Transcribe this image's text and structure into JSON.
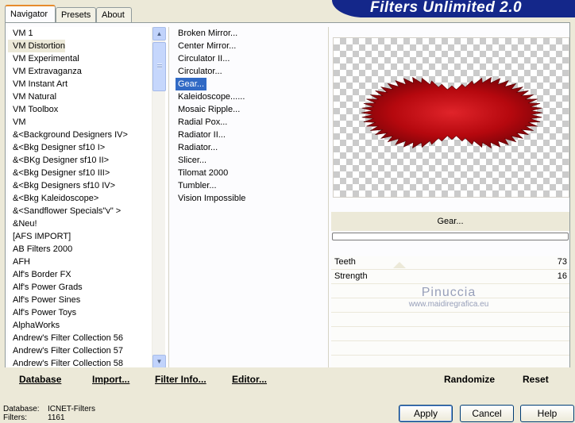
{
  "app_title": "Filters Unlimited 2.0",
  "tabs": [
    {
      "label": "Navigator",
      "active": true
    },
    {
      "label": "Presets",
      "active": false
    },
    {
      "label": "About",
      "active": false
    }
  ],
  "categories": [
    "VM 1",
    "VM Distortion",
    "VM Experimental",
    "VM Extravaganza",
    "VM Instant Art",
    "VM Natural",
    "VM Toolbox",
    "VM",
    "&<Background Designers IV>",
    "&<Bkg Designer sf10 I>",
    "&<BKg Designer sf10 II>",
    "&<Bkg Designer sf10 III>",
    "&<Bkg Designers sf10 IV>",
    "&<Bkg Kaleidoscope>",
    "&<Sandflower Specials\"v\" >",
    "&Neu!",
    "[AFS IMPORT]",
    "AB Filters 2000",
    "AFH",
    "Alf's Border FX",
    "Alf's Power Grads",
    "Alf's Power Sines",
    "Alf's Power Toys",
    "AlphaWorks",
    "Andrew's Filter Collection 56",
    "Andrew's Filter Collection 57",
    "Andrew's Filter Collection 58"
  ],
  "selected_category": "VM Distortion",
  "filters": [
    "Broken Mirror...",
    "Center Mirror...",
    "Circulator II...",
    "Circulator...",
    "Gear...",
    "Kaleidoscope......",
    "Mosaic Ripple...",
    "Radial Pox...",
    "Radiator II...",
    "Radiator...",
    "Slicer...",
    "Tilomat 2000",
    "Tumbler...",
    "Vision Impossible"
  ],
  "selected_filter": "Gear...",
  "preview": {
    "caption": "Gear...",
    "shape_color": "#b5080e",
    "shape_dark": "#7a0308",
    "shape_highlight": "#e0242a"
  },
  "parameters": [
    {
      "name": "Teeth",
      "value": "73"
    },
    {
      "name": "Strength",
      "value": "16"
    }
  ],
  "watermark": {
    "name": "Pinuccia",
    "url": "www.maidiregrafica.eu"
  },
  "toolbar": {
    "database": "Database",
    "import": "Import...",
    "filter_info": "Filter Info...",
    "editor": "Editor...",
    "randomize": "Randomize",
    "reset": "Reset"
  },
  "info": {
    "database_label": "Database:",
    "database_value": "ICNET-Filters",
    "filters_label": "Filters:",
    "filters_value": "1161"
  },
  "dialog_buttons": {
    "apply": "Apply",
    "cancel": "Cancel",
    "help": "Help"
  },
  "colors": {
    "title_band": "#14278a",
    "selection": "#316ac5",
    "tab_accent": "#e68b2c"
  }
}
